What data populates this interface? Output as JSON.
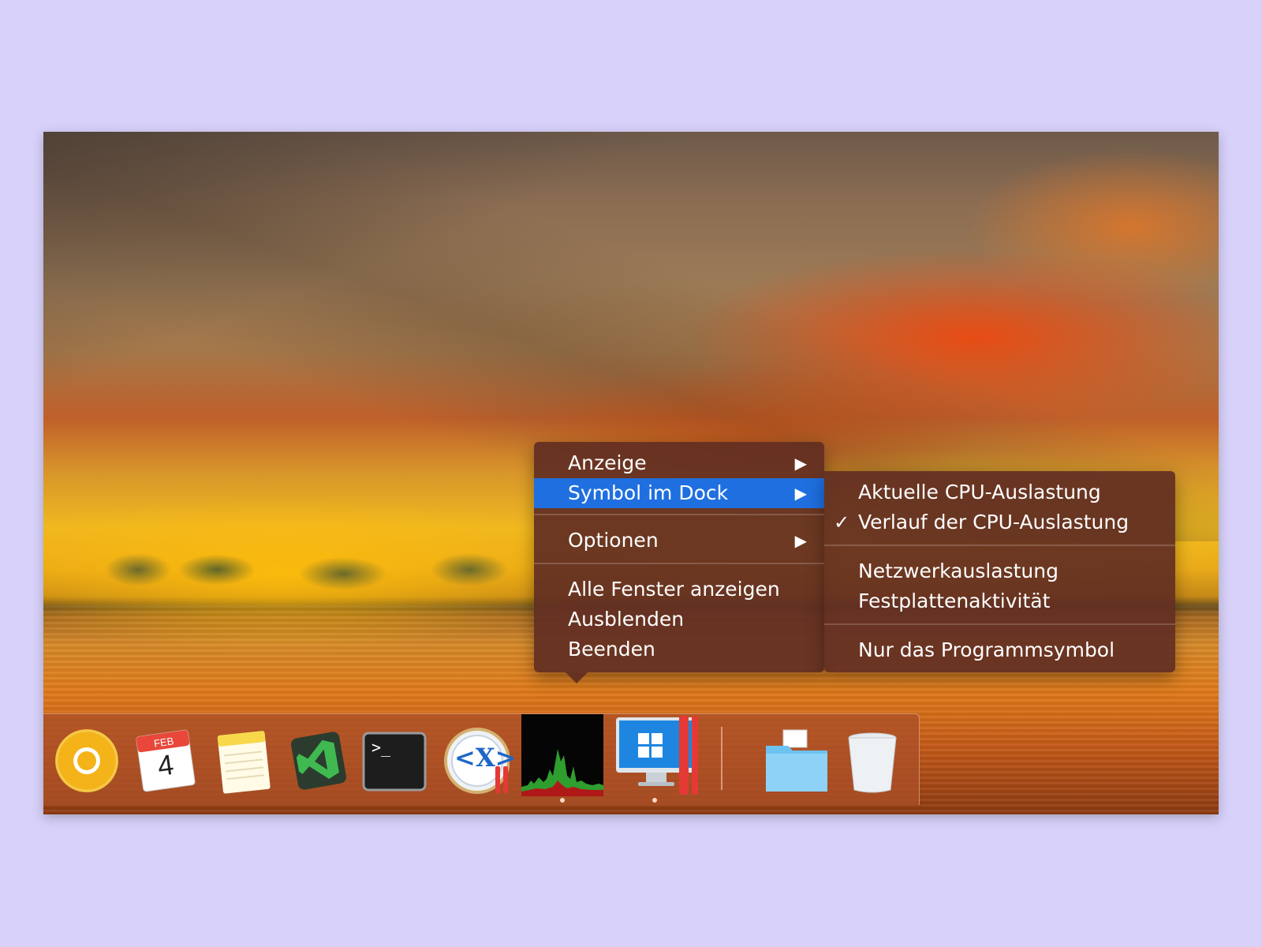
{
  "context_menu": {
    "items": [
      {
        "label": "Anzeige",
        "has_submenu": true
      },
      {
        "label": "Symbol im Dock",
        "has_submenu": true,
        "highlighted": true
      },
      {
        "label": "Optionen",
        "has_submenu": true
      },
      {
        "label": "Alle Fenster anzeigen"
      },
      {
        "label": "Ausblenden"
      },
      {
        "label": "Beenden"
      }
    ],
    "submenu_arrow": "▶",
    "highlight_color": "#1f6fe0"
  },
  "submenu": {
    "items": [
      {
        "label": "Aktuelle CPU-Auslastung"
      },
      {
        "label": "Verlauf der CPU-Auslastung",
        "checked": true
      },
      {
        "label": "Netzwerkauslastung"
      },
      {
        "label": "Festplattenaktivität"
      },
      {
        "label": "Nur das Programmsymbol"
      }
    ],
    "checkmark": "✓"
  },
  "dock": {
    "apps": [
      {
        "name": "chrome-canary-icon"
      },
      {
        "name": "calendar-icon",
        "month": "FEB",
        "day": "4"
      },
      {
        "name": "notes-icon"
      },
      {
        "name": "visual-studio-code-icon"
      },
      {
        "name": "terminal-icon",
        "prompt": ">_"
      },
      {
        "name": "xquartz-icon",
        "label": "<X>"
      },
      {
        "name": "activity-monitor-icon",
        "running": true
      },
      {
        "name": "parallels-windows-icon",
        "running": true
      },
      {
        "name": "downloads-folder-icon"
      },
      {
        "name": "trash-icon"
      }
    ]
  }
}
